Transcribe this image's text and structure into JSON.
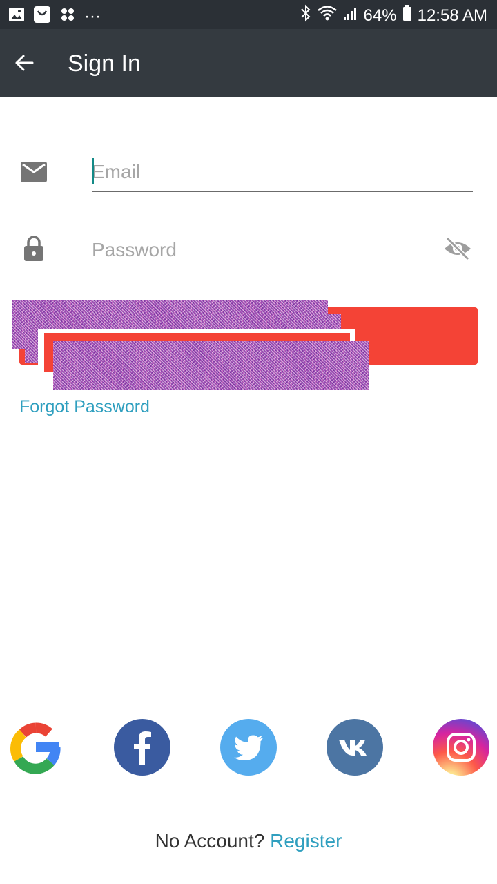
{
  "status_bar": {
    "battery": "64%",
    "time": "12:58 AM",
    "dots": "···",
    "icons": [
      "gallery-icon",
      "shopping-bag-icon",
      "pinwheel-icon",
      "bluetooth-icon",
      "wifi-icon",
      "signal-icon",
      "battery-icon"
    ]
  },
  "header": {
    "title": "Sign In",
    "back_icon": "arrow-left-icon"
  },
  "form": {
    "email_placeholder": "Email",
    "email_value": "",
    "password_placeholder": "Password",
    "password_value": "",
    "email_icon": "mail-icon",
    "password_icon": "lock-icon",
    "toggle_icon": "eye-off-icon"
  },
  "buttons": {
    "sign_in_label": "",
    "forgot_password": "Forgot Password"
  },
  "social": {
    "providers": [
      "google",
      "facebook",
      "twitter",
      "vk",
      "instagram"
    ]
  },
  "footer": {
    "no_account": "No Account?",
    "register": "Register"
  },
  "colors": {
    "appbar": "#343a40",
    "statusbar": "#2b3036",
    "primary_button": "#f44336",
    "link": "#2f9fbf",
    "cursor": "#138a87"
  }
}
